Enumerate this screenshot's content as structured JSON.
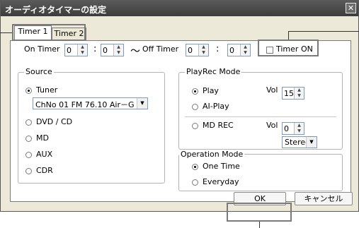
{
  "window": {
    "title": "オーディオタイマーの設定",
    "close_glyph": "✕"
  },
  "tabs": [
    {
      "label": "Timer 1"
    },
    {
      "label": "Timer 2"
    }
  ],
  "timer": {
    "on_label": "On Timer",
    "on_hour": "0",
    "on_min": "0",
    "sep_colon": ":",
    "tilde": "～",
    "off_label": "Off Timer",
    "off_hour": "0",
    "off_min": "0",
    "timer_on_label": "Timer ON"
  },
  "source": {
    "title": "Source",
    "tuner": "Tuner",
    "tuner_station": "ChNo 01  FM 76.10 Air－G'",
    "dvd": "DVD / CD",
    "md": "MD",
    "aux": "AUX",
    "cdr": "CDR"
  },
  "playrec": {
    "title": "PlayRec Mode",
    "play": "Play",
    "ai_play": "AI-Play",
    "vol_label": "Vol",
    "vol_value": "15",
    "md_rec": "MD REC",
    "md_vol_value": "0",
    "stereo": "Stereo"
  },
  "operation": {
    "title": "Operation Mode",
    "one_time": "One Time",
    "everyday": "Everyday"
  },
  "buttons": {
    "ok": "OK",
    "cancel": "キャンセル"
  },
  "icons": {
    "spin_up": "▲",
    "spin_down": "▼",
    "dropdown": "▼"
  }
}
